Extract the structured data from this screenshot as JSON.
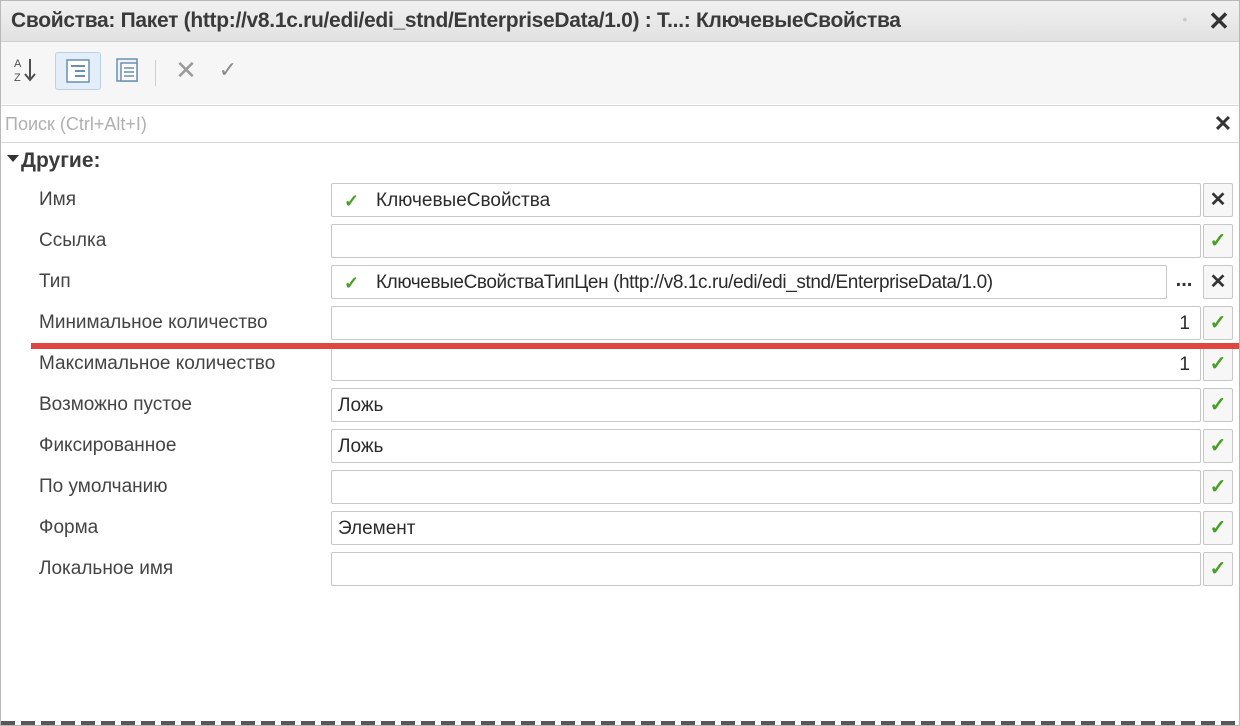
{
  "window": {
    "title": "Свойства: Пакет (http://v8.1c.ru/edi/edi_stnd/EnterpriseData/1.0) : Т...: КлючевыеСвойства",
    "close_label": "✕",
    "pin_label": "•"
  },
  "toolbar": {
    "sort_icon": "sort-az-icon",
    "categories_icon": "categories-icon",
    "filter_icon": "filter-icon",
    "cancel_label": "✕",
    "apply_label": "✓"
  },
  "search": {
    "placeholder": "Поиск (Ctrl+Alt+I)",
    "value": "",
    "clear_label": "✕"
  },
  "group": {
    "label": "Другие:"
  },
  "properties": {
    "name": {
      "label": "Имя",
      "value": "КлючевыеСвойства",
      "action": "✕"
    },
    "link": {
      "label": "Ссылка",
      "value": "",
      "action": "✓"
    },
    "type": {
      "label": "Тип",
      "value": "КлючевыеСвойстваТипЦен (http://v8.1c.ru/edi/edi_stnd/EnterpriseData/1.0)",
      "dots": "...",
      "action": "✕"
    },
    "min": {
      "label": "Минимальное количество",
      "value": "1",
      "action": "✓"
    },
    "max": {
      "label": "Максимальное количество",
      "value": "1",
      "action": "✓"
    },
    "nillable": {
      "label": "Возможно пустое",
      "value": "Ложь",
      "action": "✓"
    },
    "fixed": {
      "label": "Фиксированное",
      "value": "Ложь",
      "action": "✓"
    },
    "default": {
      "label": "По умолчанию",
      "value": "",
      "action": "✓"
    },
    "form": {
      "label": "Форма",
      "value": "Элемент",
      "action": "✓"
    },
    "local_name": {
      "label": "Локальное имя",
      "value": "",
      "action": "✓"
    }
  },
  "colors": {
    "accent_green": "#45a11f",
    "highlight_red": "#e2453f"
  }
}
